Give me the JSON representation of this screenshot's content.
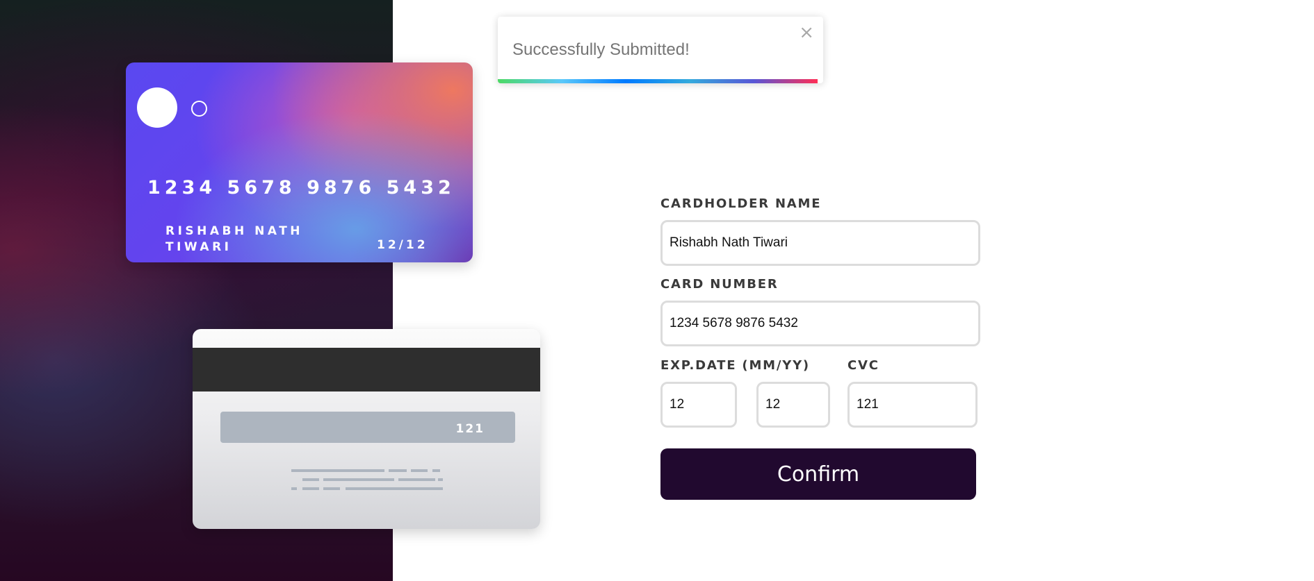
{
  "toast": {
    "message": "Successfully Submitted!",
    "close_symbol": "×"
  },
  "card_front": {
    "number": "1234 5678 9876 5432",
    "name": "RISHABH NATH TIWARI",
    "expiry": "12/12"
  },
  "card_back": {
    "cvc": "121"
  },
  "form": {
    "cardholder_label": "CARDHOLDER NAME",
    "cardholder_value": "Rishabh Nath Tiwari",
    "card_number_label": "CARD NUMBER",
    "card_number_value": "1234 5678 9876 5432",
    "exp_label": "EXP.DATE (MM/YY)",
    "exp_month_value": "12",
    "exp_year_value": "12",
    "cvc_label": "CVC",
    "cvc_value": "121",
    "confirm_label": "Confirm"
  }
}
